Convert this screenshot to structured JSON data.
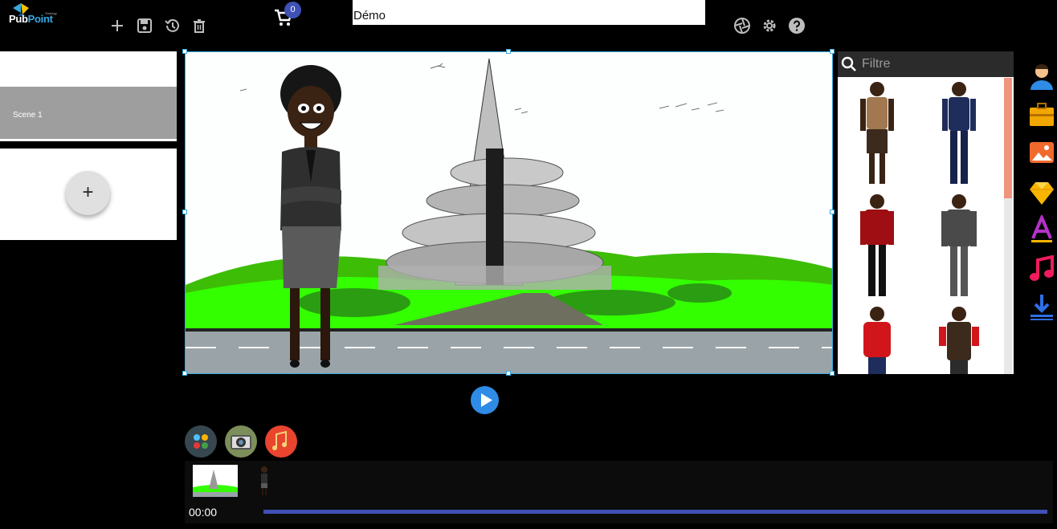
{
  "app": {
    "brand_left": "Pub",
    "brand_right": "Point",
    "brand_tag": "Strategy"
  },
  "toolbar": {
    "cart_count": "0",
    "title_value": "Démo"
  },
  "toolbar_icons": [
    "add-icon",
    "save-icon",
    "history-icon",
    "delete-icon",
    "cart-icon",
    "aperture-icon",
    "gear-icon",
    "help-icon"
  ],
  "scenes": {
    "items": [
      {
        "label": "Scene 1"
      }
    ],
    "add_label": "+"
  },
  "assets": {
    "filter_placeholder": "Filtre",
    "characters": [
      "man-brown-shirt",
      "man-navy-outfit",
      "man-red-shirt",
      "man-grey-suit",
      "man-red-arms-crossed",
      "man-brown-vest"
    ]
  },
  "right_toolbar": [
    "character-icon",
    "toolbox-icon",
    "image-icon",
    "shape-icon",
    "text-icon",
    "music-icon",
    "download-icon"
  ],
  "timeline": {
    "time": "00:00"
  },
  "colors": {
    "accent": "#3f51b5",
    "selection": "#36a9e1",
    "play": "#2e8ce6",
    "scrollbar": "#f0957a"
  }
}
